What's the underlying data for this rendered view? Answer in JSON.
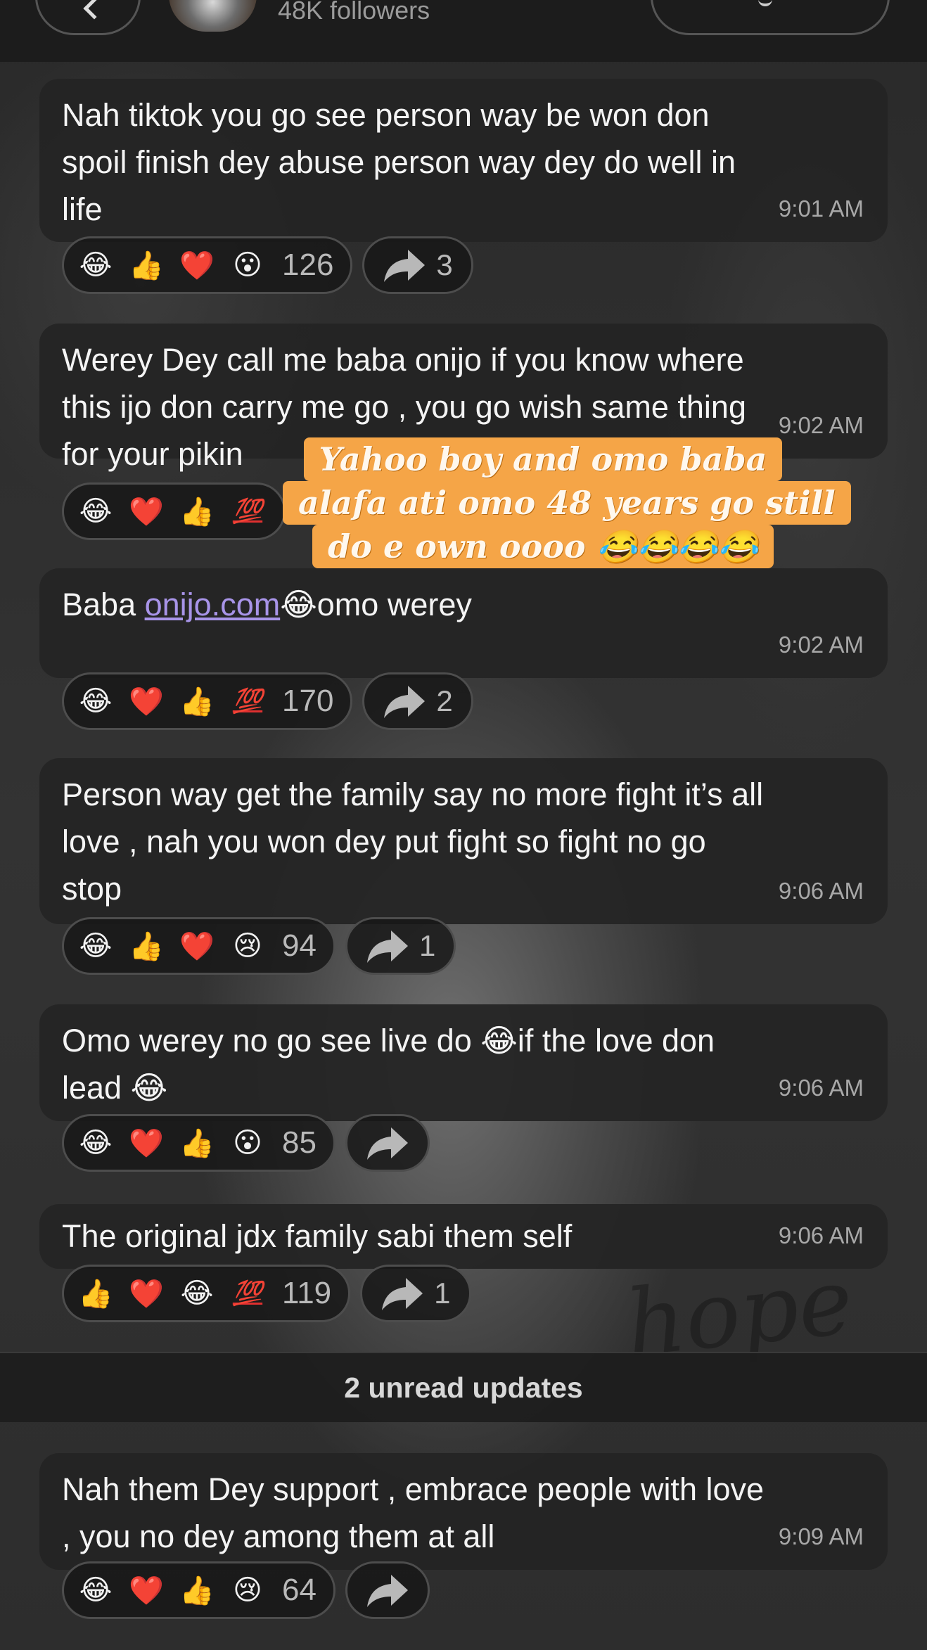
{
  "header": {
    "followers": "48K followers"
  },
  "messages": [
    {
      "text": "Nah tiktok you go see person way be won don spoil finish dey abuse person way dey do well in life",
      "time": "9:01 AM",
      "reactions": [
        "😂",
        "👍",
        "❤️",
        "😮"
      ],
      "reaction_count": "126",
      "shares": "3"
    },
    {
      "text": "Werey Dey call me baba onijo if you know where this ijo don carry me go , you go wish same thing for your pikin",
      "time": "9:02 AM",
      "reactions": [
        "😂",
        "❤️",
        "👍",
        "💯"
      ],
      "reaction_count": "",
      "shares": ""
    },
    {
      "text_before": "Baba ",
      "link": "onijo.com",
      "text_after": "😂omo werey",
      "time": "9:02 AM",
      "reactions": [
        "😂",
        "❤️",
        "👍",
        "💯"
      ],
      "reaction_count": "170",
      "shares": "2"
    },
    {
      "text": "Person way get the family say no more fight it’s all love , nah you won dey put fight so fight no go stop",
      "time": "9:06 AM",
      "reactions": [
        "😂",
        "👍",
        "❤️",
        "😢"
      ],
      "reaction_count": "94",
      "shares": "1"
    },
    {
      "text": "Omo werey no go see live do 😂if the love don lead 😂",
      "time": "9:06 AM",
      "reactions": [
        "😂",
        "❤️",
        "👍",
        "😮"
      ],
      "reaction_count": "85",
      "shares": ""
    },
    {
      "text": "The original jdx family sabi them self",
      "time": "9:06 AM",
      "reactions": [
        "👍",
        "❤️",
        "😂",
        "💯"
      ],
      "reaction_count": "119",
      "shares": "1"
    },
    {
      "text": "Nah them Dey support , embrace people with love , you no dey among them at all",
      "time": "9:09 AM",
      "reactions": [
        "😂",
        "❤️",
        "👍",
        "😢"
      ],
      "reaction_count": "64",
      "shares": ""
    }
  ],
  "unread": "2 unread updates",
  "sticker": {
    "line1": "Yahoo boy and omo baba",
    "line2": "alafa ati omo 48 years go still",
    "line3": "do e own oooo 😂😂😂😂"
  },
  "colors": {
    "bubble": "#242424",
    "link": "#a894e8",
    "sticker_bg": "#f5a547",
    "hundred": "#e03030"
  }
}
